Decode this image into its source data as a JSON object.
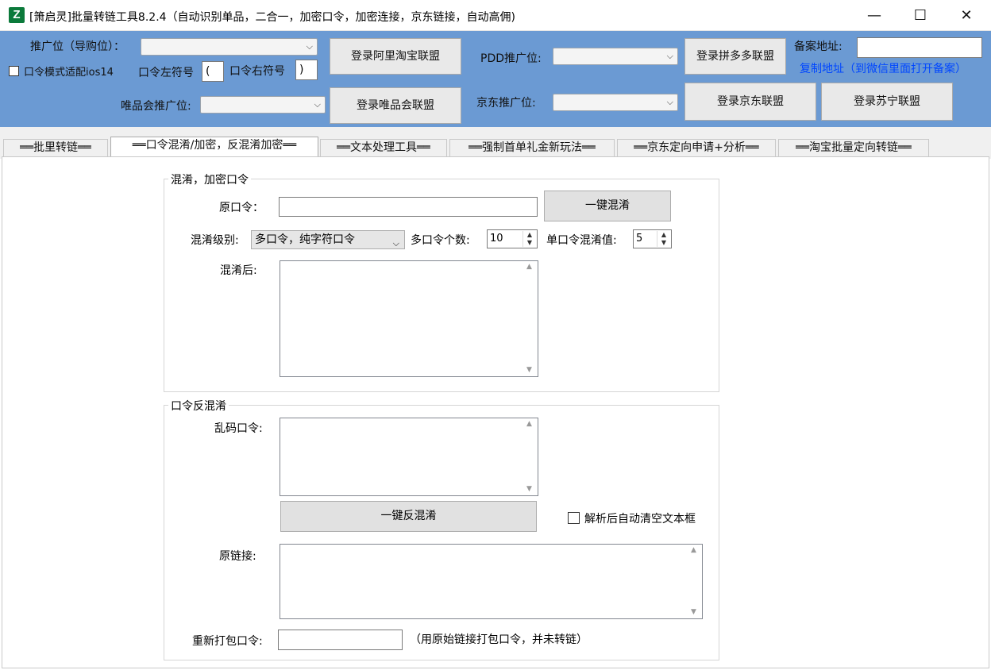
{
  "window": {
    "title": "[箫启灵]批量转链工具8.2.4（自动识别单品，二合一，加密口令，加密连接，京东链接，自动高佣)",
    "icon_letter": "Z",
    "minimize_glyph": "—",
    "maximize_glyph": "☐",
    "close_glyph": "✕"
  },
  "header": {
    "promo_slot_label": "推广位（导购位）：",
    "ios_mode_label": "口令模式适配ios14",
    "ios_mode_checked": false,
    "left_symbol_label": "口令左符号",
    "left_symbol_value": "(",
    "right_symbol_label": "口令右符号",
    "right_symbol_value": ")",
    "vip_slot_label": "唯品会推广位:",
    "login_taobao": "登录阿里淘宝联盟",
    "login_vip": "登录唯品会联盟",
    "pdd_slot_label": "PDD推广位:",
    "jd_slot_label": "京东推广位:",
    "login_pdd": "登录拼多多联盟",
    "login_jd": "登录京东联盟",
    "login_suning": "登录苏宁联盟",
    "beian_label": "备案地址:",
    "beian_value": "",
    "copy_address": "复制地址（到微信里面打开备案）",
    "dropdown_arrow": "⌵"
  },
  "tabs": [
    {
      "label": "══批里转链══"
    },
    {
      "label": "══口令混淆/加密，反混淆加密══"
    },
    {
      "label": "══文本处理工具══"
    },
    {
      "label": "══强制首单礼金新玩法══"
    },
    {
      "label": "══京东定向申请+分析══"
    },
    {
      "label": "══淘宝批量定向转链══"
    }
  ],
  "active_tab": 1,
  "obfuscate": {
    "group_title": "混淆，加密口令",
    "original_label": "原口令：",
    "original_value": "",
    "one_click_btn": "一键混淆",
    "level_label": "混淆级别:",
    "level_value": "多口令，纯字符口令",
    "multi_count_label": "多口令个数:",
    "multi_count_value": "10",
    "single_value_label": "单口令混淆值:",
    "single_value_value": "5",
    "result_label": "混淆后:",
    "result_value": ""
  },
  "deobfuscate": {
    "group_title": "口令反混淆",
    "garbled_label": "乱码口令:",
    "garbled_value": "",
    "one_click_btn": "一键反混淆",
    "auto_clear_label": "解析后自动清空文本框",
    "auto_clear_checked": false,
    "original_link_label": "原链接:",
    "original_link_value": "",
    "repack_label": "重新打包口令:",
    "repack_value": "",
    "repack_note": "（用原始链接打包口令，并未转链）"
  },
  "colors": {
    "header_bg": "#6b9ad3",
    "link_blue": "#0046ff",
    "icon_green": "#0b7a3b"
  }
}
